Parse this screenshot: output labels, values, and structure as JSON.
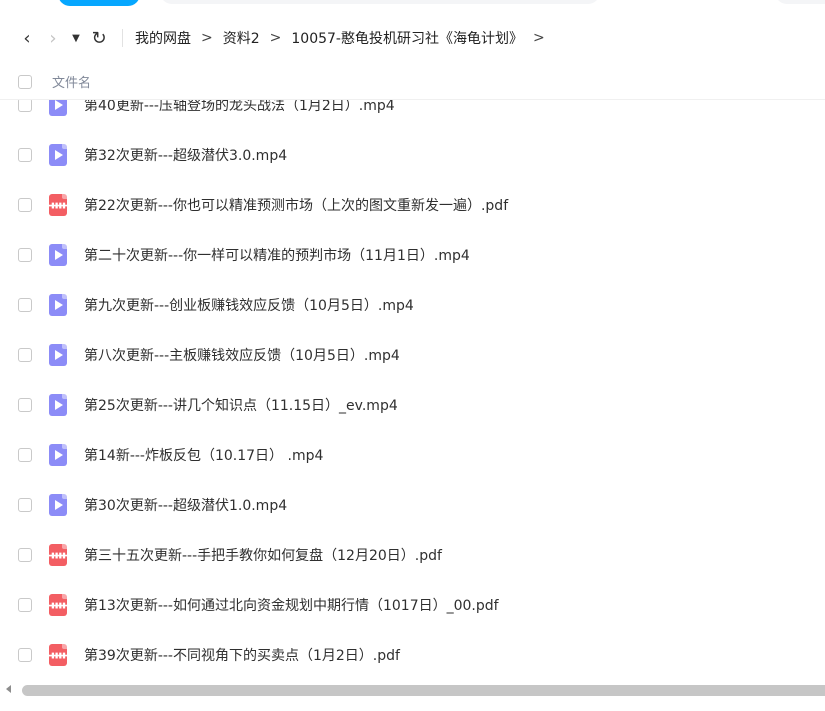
{
  "toolbar": {
    "back_icon": "chevron-left-icon",
    "forward_icon": "chevron-right-icon",
    "dropdown_icon": "caret-down-icon",
    "refresh_icon": "refresh-icon",
    "back_glyph": "‹",
    "forward_glyph": "›",
    "dropdown_glyph": "▼",
    "refresh_glyph": "↻"
  },
  "breadcrumb": {
    "separator": ">",
    "items": [
      "我的网盘",
      "资料2",
      "10057-憨龟投机研习社《海龟计划》"
    ]
  },
  "list_header": {
    "name_label": "文件名"
  },
  "files": [
    {
      "name": "第40更新---压轴登场的龙头战法（1月2日）.mp4",
      "type": "video"
    },
    {
      "name": "第32次更新---超级潜伏3.0.mp4",
      "type": "video"
    },
    {
      "name": "第22次更新---你也可以精准预测市场（上次的图文重新发一遍）.pdf",
      "type": "pdf"
    },
    {
      "name": "第二十次更新---你一样可以精准的预判市场（11月1日）.mp4",
      "type": "video"
    },
    {
      "name": "第九次更新---创业板赚钱效应反馈（10月5日）.mp4",
      "type": "video"
    },
    {
      "name": "第八次更新---主板赚钱效应反馈（10月5日）.mp4",
      "type": "video"
    },
    {
      "name": "第25次更新---讲几个知识点（11.15日）_ev.mp4",
      "type": "video"
    },
    {
      "name": "第14新---炸板反包（10.17日） .mp4",
      "type": "video"
    },
    {
      "name": "第30次更新---超级潜伏1.0.mp4",
      "type": "video"
    },
    {
      "name": "第三十五次更新---手把手教你如何复盘（12月20日）.pdf",
      "type": "pdf"
    },
    {
      "name": "第13次更新---如何通过北向资金规划中期行情（1017日）_00.pdf",
      "type": "pdf"
    },
    {
      "name": "第39次更新---不同视角下的买卖点（1月2日）.pdf",
      "type": "pdf"
    }
  ],
  "colors": {
    "video_icon": "#8c8cf7",
    "pdf_icon": "#f35e63",
    "accent": "#06a7ff"
  }
}
